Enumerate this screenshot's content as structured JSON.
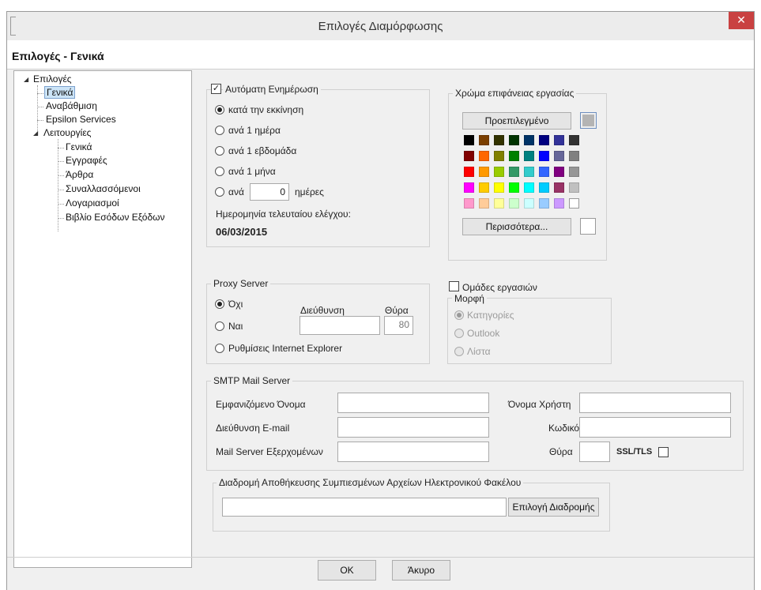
{
  "window": {
    "title": "Επιλογές Διαμόρφωσης",
    "close_glyph": "✕"
  },
  "header": {
    "title": "Επιλογές - Γενικά"
  },
  "tree": {
    "root": "Επιλογές",
    "items": [
      "Γενικά",
      "Αναβάθμιση",
      "Epsilon Services"
    ],
    "sub_parent": "Λειτουργίες",
    "sub_items": [
      "Γενικά",
      "Εγγραφές",
      "Άρθρα",
      "Συναλλασσόμενοι",
      "Λογαριασμοί",
      "Βιβλίο Εσόδων Εξόδων"
    ]
  },
  "auto_update": {
    "label": "Αυτόματη Ενημέρωση",
    "checked": true,
    "options": [
      "κατά την εκκίνηση",
      "ανά 1 ημέρα",
      "ανά 1 εβδομάδα",
      "ανά 1 μήνα",
      "ανά"
    ],
    "selected": 0,
    "days_value": "0",
    "days_unit": "ημέρες",
    "last_check_label": "Ημερομηνία τελευταίου ελέγχου:",
    "last_check_value": "06/03/2015"
  },
  "desktop_color": {
    "title": "Χρώμα επιφάνειας εργασίας",
    "default_label": "Προεπιλεγμένο",
    "more_label": "Περισσότερα...",
    "current_color": "#b4b4b4",
    "palette": [
      [
        "#000000",
        "#7b3f00",
        "#333300",
        "#003300",
        "#003366",
        "#000080",
        "#333399",
        "#333333"
      ],
      [
        "#800000",
        "#ff6600",
        "#808000",
        "#008000",
        "#008080",
        "#0000ff",
        "#666699",
        "#808080"
      ],
      [
        "#ff0000",
        "#ff9900",
        "#99cc00",
        "#339966",
        "#33cccc",
        "#3366ff",
        "#800080",
        "#969696"
      ],
      [
        "#ff00ff",
        "#ffcc00",
        "#ffff00",
        "#00ff00",
        "#00ffff",
        "#00ccff",
        "#993366",
        "#c0c0c0"
      ],
      [
        "#ff99cc",
        "#ffcc99",
        "#ffff99",
        "#ccffcc",
        "#ccffff",
        "#99ccff",
        "#cc99ff",
        "#ffffff"
      ]
    ]
  },
  "proxy": {
    "title": "Proxy Server",
    "options": [
      "Όχι",
      "Ναι",
      "Ρυθμίσεις Internet Explorer"
    ],
    "selected": 0,
    "address_label": "Διεύθυνση",
    "port_label": "Θύρα",
    "address_value": "",
    "port_value": "80"
  },
  "workgroups": {
    "label": "Ομάδες εργασιών",
    "checked": false,
    "format_title": "Μορφή",
    "options": [
      "Κατηγορίες",
      "Outlook",
      "Λίστα"
    ],
    "selected": 0
  },
  "smtp": {
    "title": "SMTP Mail Server",
    "display_name_label": "Εμφανιζόμενο Όνομα",
    "email_label": "Διεύθυνση E-mail",
    "outgoing_label": "Mail Server Εξερχομένων",
    "username_label": "Όνομα Χρήστη",
    "password_label": "Κωδικός",
    "port_label": "Θύρα",
    "ssl_label": "SSL/TLS",
    "display_name_value": "",
    "email_value": "",
    "outgoing_value": "",
    "username_value": "",
    "password_value": "",
    "port_value": "",
    "ssl_checked": false
  },
  "archive": {
    "title": "Διαδρομή Αποθήκευσης Συμπιεσμένων Αρχείων Ηλεκτρονικού Φακέλου",
    "path_value": "",
    "browse_label": "Επιλογή Διαδρομής"
  },
  "footer": {
    "ok_label": "OK",
    "cancel_label": "Άκυρο"
  }
}
